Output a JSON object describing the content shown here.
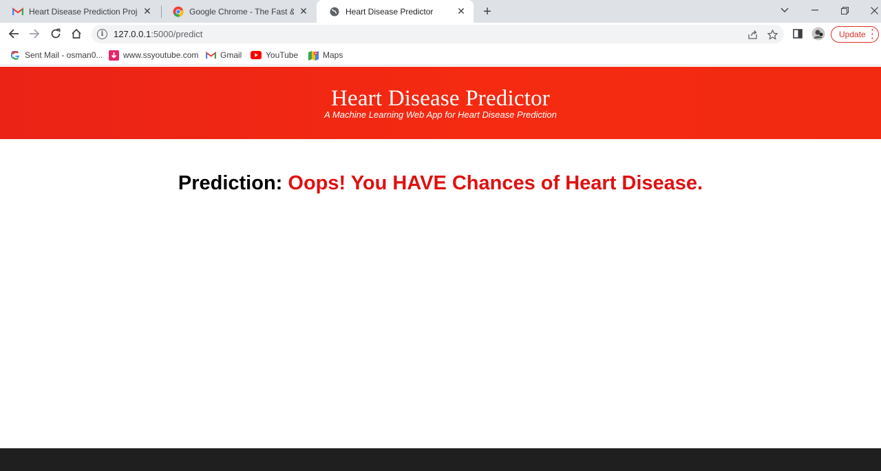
{
  "tabs": [
    {
      "title": "Heart Disease Prediction Project",
      "favicon": "gmail-icon"
    },
    {
      "title": "Google Chrome - The Fast & Secure",
      "favicon": "chrome-icon"
    },
    {
      "title": "Heart Disease Predictor",
      "favicon": "globe-icon",
      "active": true
    }
  ],
  "address": {
    "host": "127.0.0.1",
    "path": ":5000/predict"
  },
  "update_label": "Update",
  "bookmarks": [
    {
      "label": "Sent Mail - osman0...",
      "icon": "google-icon"
    },
    {
      "label": "www.ssyoutube.com",
      "icon": "ssyoutube-icon"
    },
    {
      "label": "Gmail",
      "icon": "gmail-icon"
    },
    {
      "label": "YouTube",
      "icon": "youtube-icon"
    },
    {
      "label": "Maps",
      "icon": "maps-icon"
    }
  ],
  "page": {
    "title": "Heart Disease Predictor",
    "subtitle": "A Machine Learning Web App for Heart Disease Prediction",
    "prediction_label": "Prediction:",
    "prediction_result": "Oops! You HAVE Chances of Heart Disease."
  },
  "colors": {
    "header_red": "#f2281a",
    "result_red": "#e01010",
    "taskbar": "#1f1f1f"
  }
}
